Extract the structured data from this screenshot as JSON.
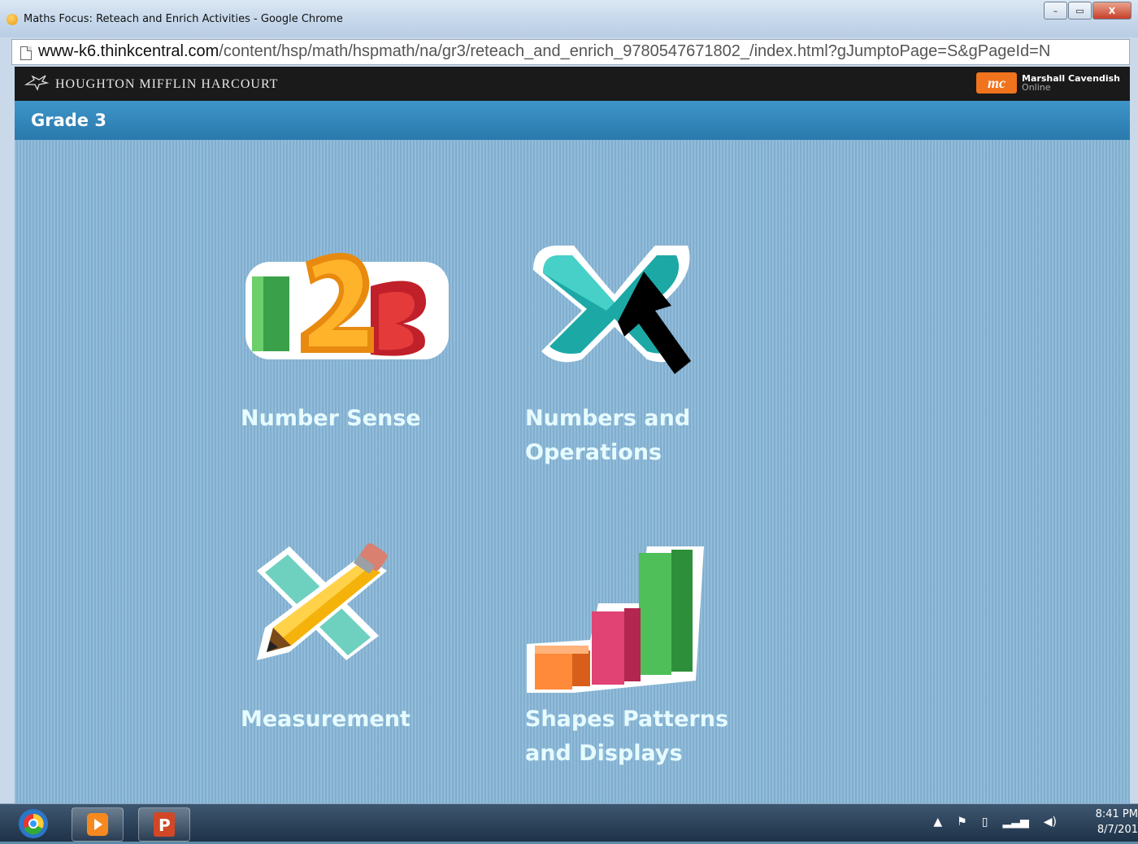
{
  "window": {
    "title": "Maths Focus: Reteach and Enrich Activities - Google Chrome",
    "controls": {
      "minimize": "–",
      "maximize": "▭",
      "close": "X"
    }
  },
  "address_bar": {
    "host": "www-k6.thinkcentral.com",
    "path": "/content/hsp/math/hspmath/na/gr3/reteach_and_enrich_9780547671802_/index.html?gJumptoPage=S&gPageId=N"
  },
  "header": {
    "publisher": "HOUGHTON MIFFLIN HARCOURT",
    "partner_logo": "mc",
    "partner_name": "Marshall Cavendish",
    "partner_sub": "Online"
  },
  "grade_bar": {
    "title": "Grade 3"
  },
  "tiles": [
    {
      "label_line1": "Number Sense",
      "label_line2": "",
      "icon": "numbers-123-icon"
    },
    {
      "label_line1": "Numbers and",
      "label_line2": "Operations",
      "icon": "multiply-sign-icon"
    },
    {
      "label_line1": "Measurement",
      "label_line2": "",
      "icon": "pencil-ruler-icon"
    },
    {
      "label_line1": "Shapes Patterns",
      "label_line2": "and Displays",
      "icon": "bar-graph-icon"
    }
  ],
  "colors": {
    "accent": "#2a79ad",
    "tile_label": "#e6fbff",
    "background": "#86b5d6"
  },
  "taskbar": {
    "apps": [
      "chrome-icon",
      "media-player-icon",
      "powerpoint-icon"
    ],
    "time": "8:41 PM",
    "date": "8/7/201"
  }
}
